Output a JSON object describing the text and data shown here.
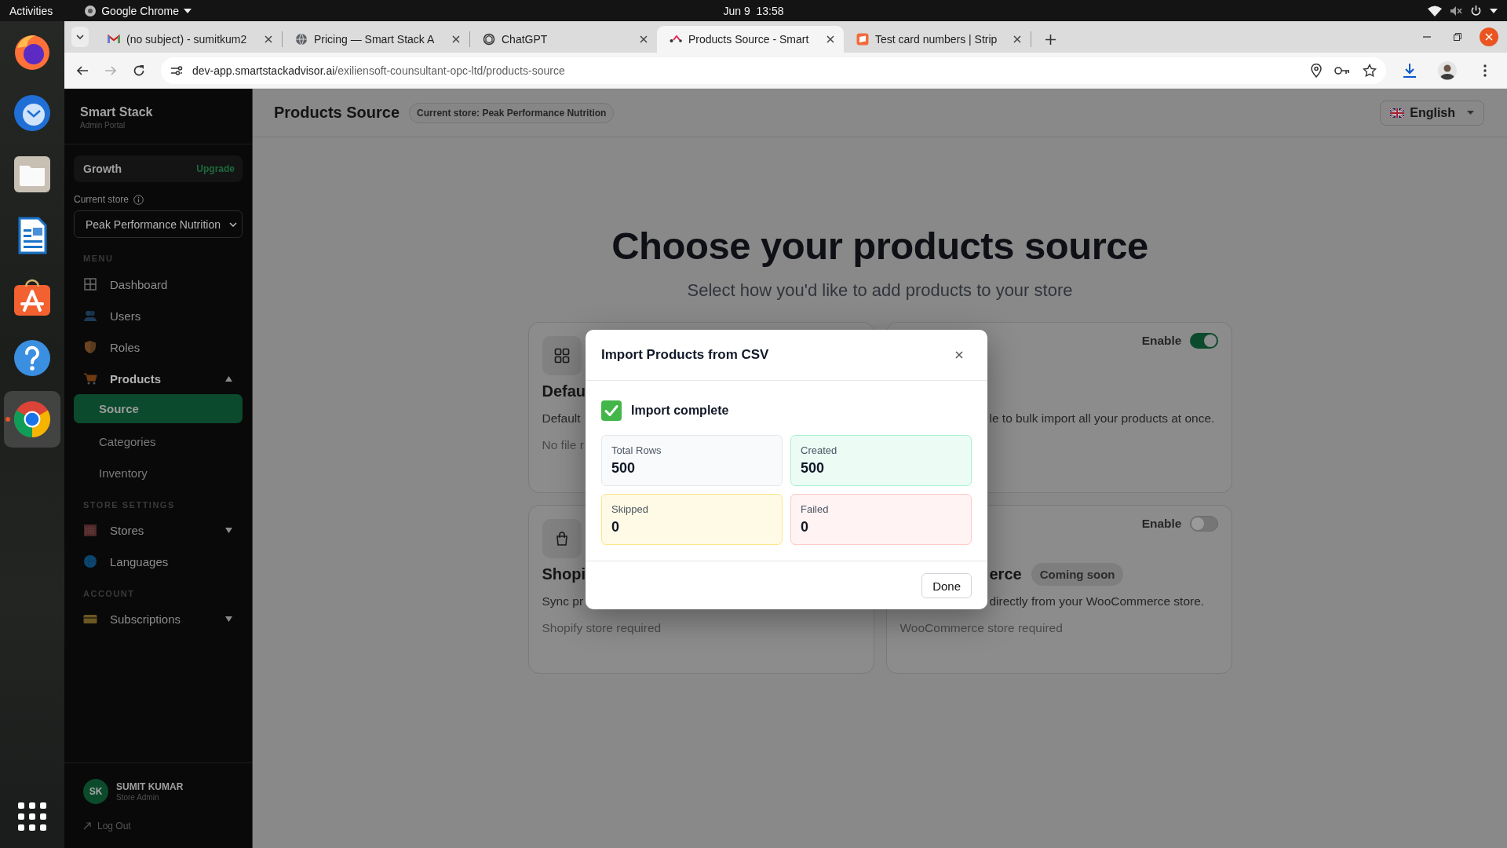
{
  "top_bar": {
    "activities": "Activities",
    "app_menu": "Google Chrome",
    "clock": "Jun 9  13:58"
  },
  "dock": {
    "items": [
      {
        "kind": "fox",
        "active": false
      },
      {
        "kind": "bird",
        "active": false
      },
      {
        "kind": "folder",
        "active": false
      },
      {
        "kind": "document",
        "active": false
      },
      {
        "kind": "bag",
        "active": false
      },
      {
        "kind": "help",
        "active": false
      },
      {
        "kind": "chrome",
        "active": true
      }
    ]
  },
  "browser": {
    "tabs": [
      {
        "kind": "mail",
        "title": "(no subject) - sumitkum2",
        "selected": false
      },
      {
        "kind": "globe",
        "title": "Pricing — Smart Stack A",
        "selected": false
      },
      {
        "kind": "knot",
        "title": "ChatGPT",
        "selected": false
      },
      {
        "kind": "dots",
        "title": "Products Source - Smart",
        "selected": true
      },
      {
        "kind": "square",
        "title": "Test card numbers | Strip",
        "selected": false
      }
    ],
    "forward_enabled": false,
    "url_host": "dev-app.smartstackadvisor.ai",
    "url_path": "/exiliensoft-counsultant-opc-ltd/products-source"
  },
  "sidebar": {
    "brand": "Smart Stack",
    "subtitle": "Admin Portal",
    "plan": {
      "name": "Growth",
      "action": "Upgrade"
    },
    "store_label": "Current store",
    "store_value": "Peak Performance Nutrition",
    "sections": [
      {
        "title": "MENU",
        "items": [
          {
            "kind": "dashboard",
            "label": "Dashboard"
          },
          {
            "kind": "users",
            "label": "Users"
          },
          {
            "kind": "roles",
            "label": "Roles"
          },
          {
            "kind": "products",
            "label": "Products",
            "expanded": true,
            "children": [
              {
                "label": "Source",
                "selected": true
              },
              {
                "label": "Categories",
                "selected": false
              },
              {
                "label": "Inventory",
                "selected": false
              }
            ]
          }
        ]
      },
      {
        "title": "STORE SETTINGS",
        "items": [
          {
            "kind": "stores",
            "label": "Stores",
            "expanded": false
          },
          {
            "kind": "languages",
            "label": "Languages"
          }
        ]
      },
      {
        "title": "ACCOUNT",
        "items": [
          {
            "kind": "subscriptions",
            "label": "Subscriptions",
            "expanded": false
          }
        ]
      }
    ],
    "user": {
      "initials": "SK",
      "name": "SUMIT KUMAR",
      "role": "Store Admin"
    },
    "logout": "Log Out"
  },
  "header": {
    "title": "Products Source",
    "store_badge": "Current store: Peak Performance Nutrition",
    "language": "English"
  },
  "hero": {
    "title": "Choose your products source",
    "subtitle": "Select how you'd like to add products to your store"
  },
  "sources": [
    {
      "kind": "grid",
      "title": "Defau",
      "description": "Default",
      "note": "No file r"
    },
    {
      "enable_label": "Enable",
      "enabled": true,
      "description": "le to bulk import all your products at once."
    },
    {
      "kind": "bag",
      "title": "Shopi",
      "description": "Sync pr",
      "note": "Shopify store required"
    },
    {
      "enable_label": "Enable",
      "enabled": false,
      "title": "erce",
      "badge": "Coming soon",
      "description": "directly from your WooCommerce store.",
      "note": "WooCommerce store required"
    }
  ],
  "modal": {
    "title": "Import Products from CSV",
    "status": "Import complete",
    "stats": [
      {
        "label": "Total Rows",
        "value": "500",
        "color": "#e5e7eb"
      },
      {
        "label": "Created",
        "value": "500",
        "color": "#a7f3d0"
      },
      {
        "label": "Skipped",
        "value": "0",
        "color": "#fde68a"
      },
      {
        "label": "Failed",
        "value": "0",
        "color": "#fecaca"
      }
    ],
    "done": "Done"
  }
}
